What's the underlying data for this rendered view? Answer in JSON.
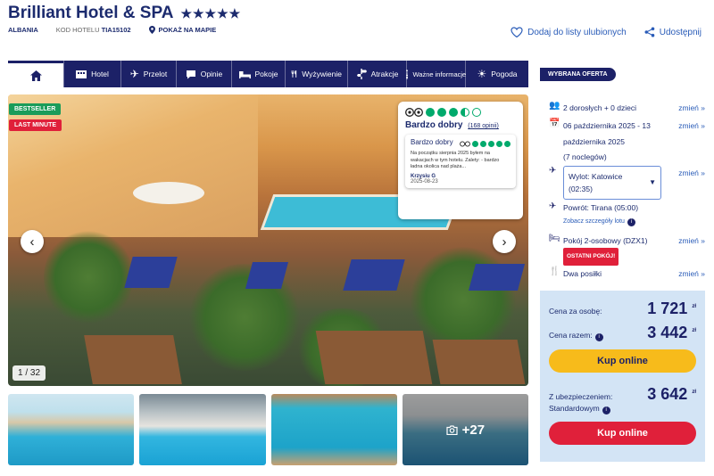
{
  "header": {
    "title": "Brilliant Hotel & SPA",
    "stars": "★★★★★",
    "country": "ALBANIA",
    "code_label": "KOD HOTELU",
    "code_value": "TIA15102",
    "map_link": "POKAŻ NA MAPIE",
    "favorite_label": "Dodaj do listy ulubionych",
    "share_label": "Udostępnij"
  },
  "nav": {
    "tabs": [
      {
        "label": "Hotel",
        "icon": "hotel-icon"
      },
      {
        "label": "Przelot",
        "icon": "plane-icon"
      },
      {
        "label": "Opinie",
        "icon": "chat-icon"
      },
      {
        "label": "Pokoje",
        "icon": "bed-icon"
      },
      {
        "label": "Wyżywienie",
        "icon": "cutlery-icon"
      },
      {
        "label": "Atrakcje",
        "icon": "signpost-icon"
      },
      {
        "label": "Ważne informacje",
        "icon": "info-icon"
      },
      {
        "label": "Pogoda",
        "icon": "sun-icon"
      }
    ]
  },
  "gallery": {
    "badge_bestseller": "BESTSELLER",
    "badge_last_minute": "LAST MINUTE",
    "counter": "1 / 32",
    "more_photos": "+27"
  },
  "tripadvisor": {
    "rating": 3.5,
    "label": "Bardzo dobry",
    "review_count": "(168 opinii)",
    "review": {
      "title": "Bardzo dobry",
      "rating": 5,
      "text": "Na początku sierpnia 2025 byłem na wakacjach w tym hotelu. Zalety: - bardzo ładna okolica nad plaża...",
      "author": "Krzysiu G",
      "date": "2025-08-23"
    }
  },
  "offer": {
    "tag": "WYBRANA OFERTA",
    "change_label": "zmień »",
    "people": "2 dorosłych + 0 dzieci",
    "dates": "06 października 2025 - 13 października 2025",
    "nights": "(7 noclegów)",
    "departure_line1": "Wylot: Katowice",
    "departure_line2": "(02:35)",
    "return": "Powrót: Tirana (05:00)",
    "flight_details": "Zobacz szczegóły lotu",
    "room": "Pokój 2-osobowy (DZX1)",
    "last_rooms": "OSTATNI POKÓJ!",
    "board": "Dwa posiłki"
  },
  "price": {
    "per_person_label": "Cena za osobę:",
    "per_person_value": "1 721",
    "total_label": "Cena razem:",
    "total_value": "3 442",
    "currency": "zł",
    "buy_label": "Kup online",
    "insurance_label_1": "Z ubezpieczeniem:",
    "insurance_label_2": "Standardowym",
    "insurance_value": "3 642",
    "buy_insured_label": "Kup online"
  },
  "colors": {
    "navy": "#1c2167",
    "accent_blue": "#2a5cb8",
    "yellow": "#f7bb1b",
    "red": "#e0203a",
    "price_bg": "#d3e4f5",
    "tripadvisor_green": "#00aa6c"
  }
}
